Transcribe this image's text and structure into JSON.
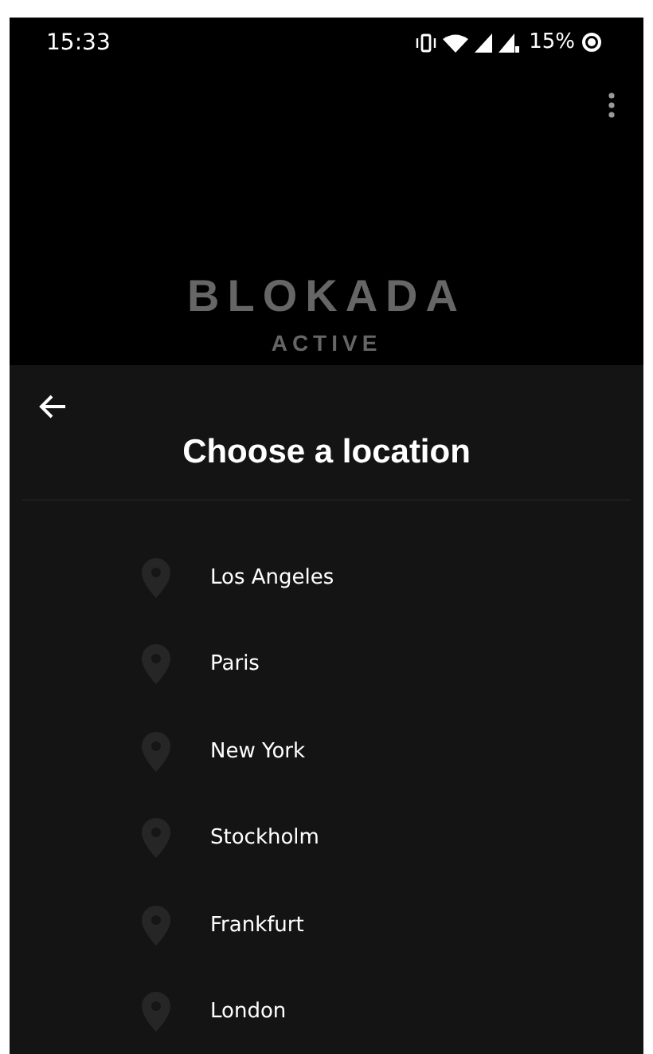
{
  "status_bar": {
    "time": "15:33",
    "battery": "15%"
  },
  "header": {
    "logo": "BLOKADA",
    "status": "ACTIVE"
  },
  "sheet": {
    "title": "Choose a location",
    "locations": [
      {
        "name": "Los Angeles"
      },
      {
        "name": "Paris"
      },
      {
        "name": "New York"
      },
      {
        "name": "Stockholm"
      },
      {
        "name": "Frankfurt"
      },
      {
        "name": "London"
      }
    ]
  }
}
